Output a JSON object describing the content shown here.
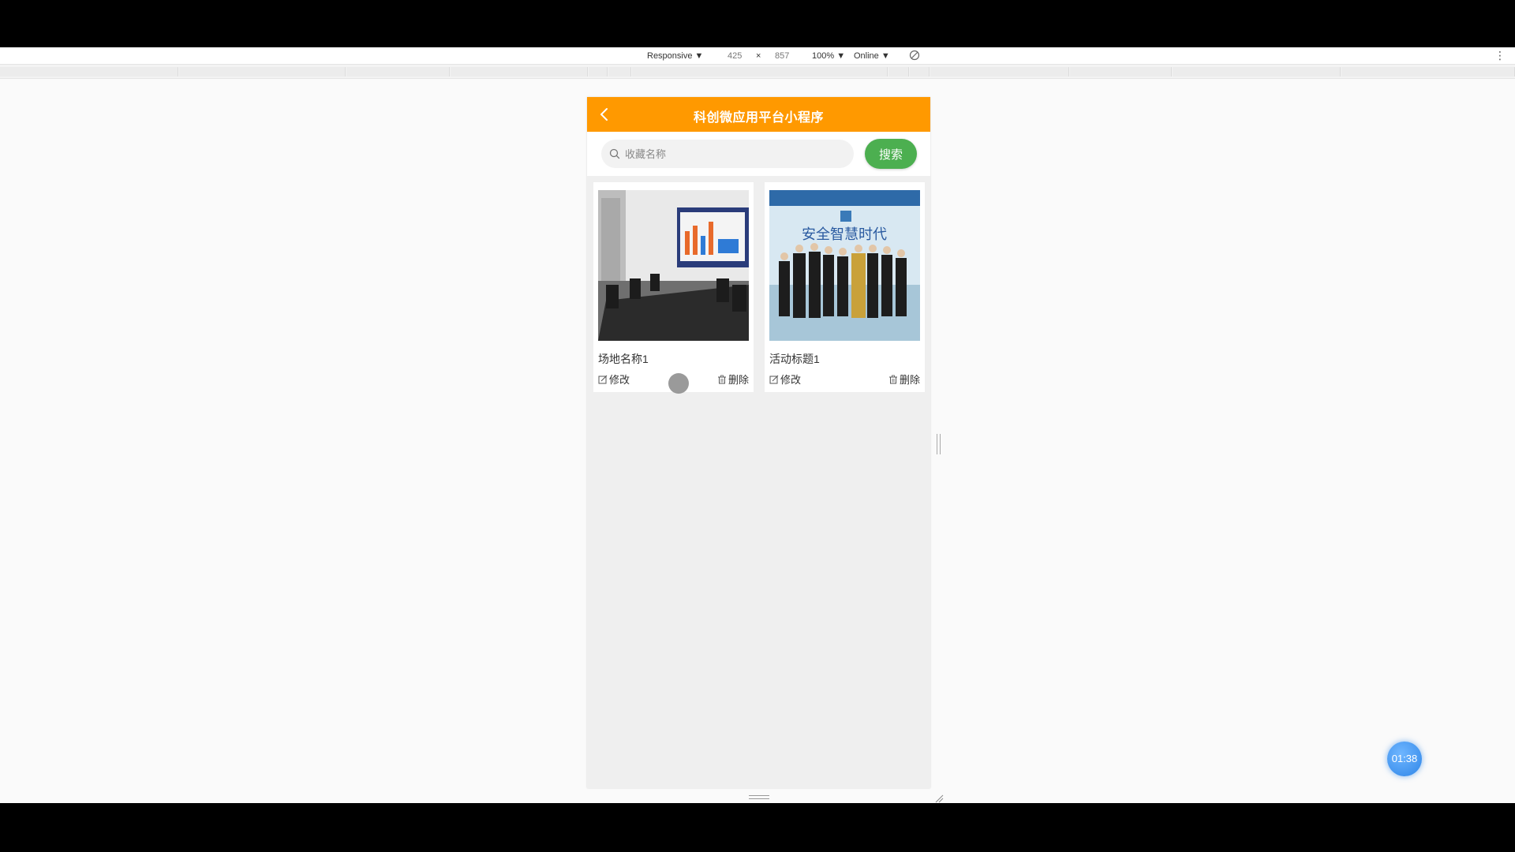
{
  "devtools": {
    "device": "Responsive ▼",
    "width": "425",
    "times": "×",
    "height": "857",
    "zoom": "100% ▼",
    "network": "Online ▼"
  },
  "app": {
    "title": "科创微应用平台小程序",
    "accent": "#ff9900"
  },
  "search": {
    "placeholder": "收藏名称",
    "button_label": "搜索",
    "button_color": "#4caf50"
  },
  "cards": [
    {
      "title": "场地名称1",
      "edit_label": "修改",
      "delete_label": "删除",
      "image": "conference-room-photo"
    },
    {
      "title": "活动标题1",
      "edit_label": "修改",
      "delete_label": "删除",
      "image": "group-photo-event"
    }
  ],
  "timer": {
    "value": "01:38"
  }
}
